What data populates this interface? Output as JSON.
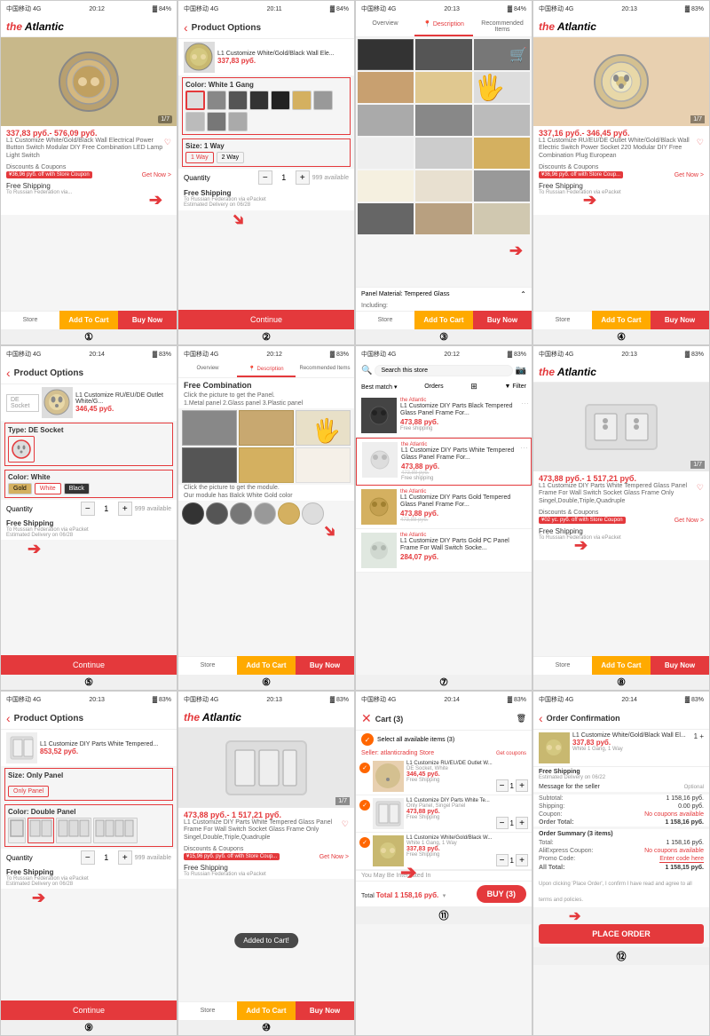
{
  "cells": [
    {
      "id": 1,
      "type": "product_detail",
      "logo": "the Atlantic",
      "status": "中国移动 4G  20:12  84%",
      "product_img": "round_switch_gold",
      "price": "337,83 руб.- 576,09 руб.",
      "desc": "L1 Customize White/Gold/Black Wall Electrical Power Button Switch Modular DIY Free Combination LED Lamp Light Switch",
      "discount_text": "¥36,96 руб. off with Store Coupon",
      "free_shipping": "Free Shipping",
      "ship_sub": "To Russian Federation via...",
      "has_arrow": true,
      "arrow_pos": "left",
      "num": "①"
    },
    {
      "id": 2,
      "type": "product_options",
      "status": "中国移动 4G  20:11  84%",
      "title": "Product Options",
      "product_name": "L1 Customize White/Gold/Black Wall Ele...",
      "price": "337,83 руб.",
      "color_label": "Color: White 1 Gang",
      "size_label": "Size: 1 Way",
      "size_options": [
        "1 Way",
        "2 Way"
      ],
      "qty_label": "Quantity",
      "free_shipping": "Free Shipping",
      "ship_sub": "To Russian Federation via ePacket\nEstimated Delivery on 06/28",
      "has_arrow": true,
      "num": "②"
    },
    {
      "id": 3,
      "type": "product_gallery",
      "status": "中国移动 4G  20:13  84%",
      "tabs": [
        "Overview",
        "Description",
        "Recommended Items"
      ],
      "panel_label": "Panel Material: Tempered Glass",
      "including": "Including:",
      "has_cart_icon": true,
      "has_arrow": true,
      "num": "③"
    },
    {
      "id": 4,
      "type": "product_detail",
      "logo": "the Atlantic",
      "status": "中国移动 4G  20:13  83%",
      "product_img": "round_socket_white",
      "price": "337,16 руб.- 346,45 руб.",
      "desc": "L1 Customize RU/EU/DE Outlet White/Gold/Black Wall Electric Switch Power Socket 220 Modular DIY Free Combination Plug European",
      "discount_text": "¥36,96 руб. off with Store Coup...",
      "free_shipping": "Free Shipping",
      "ship_sub": "To Russian Federation via ePacket",
      "has_arrow": true,
      "num": "④"
    },
    {
      "id": 5,
      "type": "product_options_2",
      "status": "中国移动 4G  20:14  83%",
      "title": "Product Options",
      "product_name": "L1 Customize RU/EU/DE Outlet White/G...",
      "price": "346,45 руб.",
      "type_label": "Type: DE Socket",
      "color_label": "Color: White",
      "colors": [
        "Gold",
        "White",
        "Black"
      ],
      "qty_label": "Quantity",
      "free_shipping": "Free Shipping",
      "ship_sub": "To Russian Federation via ePacket\nEstimated Delivery on 06/28",
      "has_arrow": true,
      "num": "⑤"
    },
    {
      "id": 6,
      "type": "free_combination",
      "status": "中国移动 4G  20:12  83%",
      "tabs": [
        "Overview",
        "Description",
        "Recommended Items"
      ],
      "title": "Free Combination",
      "sub1": "Click the picture to get the Panel.",
      "sub2": "1.Metal panel  2.Glass panel  3.Plastic panel",
      "sub3": "Click the picture to get the module.",
      "sub4": "Our module has Back White Gold color",
      "has_arrow": true,
      "num": "⑥"
    },
    {
      "id": 7,
      "type": "search_results",
      "status": "中国移动 4G  20:12  83%",
      "search_placeholder": "Search this store",
      "sort_label": "Best match",
      "orders_label": "Orders",
      "filter_label": "Filter",
      "items": [
        {
          "brand": "the Atlantic",
          "name": "L1 Customize DIY Parts Black Tempered Glass Panel Frame For...",
          "price": "473,88 руб.",
          "old_price": "",
          "shipping": "Free shipping"
        },
        {
          "brand": "the Atlantic",
          "name": "L1 Customize DIY Parts White Tempered Glass Panel Frame For...",
          "price": "473,88 руб.",
          "old_price": "473,88 руб.",
          "shipping": "Free shipping"
        },
        {
          "brand": "the Atlantic",
          "name": "L1 Customize DIY Parts Gold Tempered Glass Panel Frame For...",
          "price": "473,88 руб.",
          "old_price": "473,88 руб.",
          "shipping": "Free shipping"
        },
        {
          "brand": "the Atlantic",
          "name": "L1 Customize DIY Parts Gold PC Panel Frame For Wall Switch Socke...",
          "price": "284,07 руб.",
          "old_price": "",
          "shipping": ""
        }
      ],
      "has_arrow": true,
      "num": "⑦"
    },
    {
      "id": 8,
      "type": "product_detail_2",
      "logo": "the Atlantic",
      "status": "中国移动 4G  20:13  83%",
      "product_img": "frame_panel_white",
      "price": "473,88 руб.- 1 517,21 руб.",
      "desc": "L1 Customize DIY Parts White Tempered Glass Panel Frame For Wall Switch Socket Glass Frame Only Singel,Double,Triple,Quadruple",
      "discount_text": "¥02 ус. руб. off with Store Coupon",
      "free_shipping": "Free Shipping",
      "ship_sub": "To Russian Federation via ePacket",
      "has_arrow": true,
      "num": "⑧"
    },
    {
      "id": 9,
      "type": "product_options_3",
      "status": "中国移动 4G  20:13  83%",
      "title": "Product Options",
      "product_name": "L1 Customize DIY Parts White Tempered...",
      "price": "853,52 руб.",
      "size_label": "Size: Only Panel",
      "size_options": [
        "Only Panel"
      ],
      "color_label": "Color: Double Panel",
      "qty_label": "Quantity",
      "free_shipping": "Free Shipping",
      "ship_sub": "To Russian Federation via ePacket\nEstimated Delivery on 06/28",
      "has_arrow": true,
      "num": "⑨"
    },
    {
      "id": 10,
      "type": "product_detail_3",
      "logo": "the Atlantic",
      "status": "中国移动 4G  20:13  83%",
      "product_img": "frame_panel_white_2",
      "price": "473,88 руб.- 1 517,21 руб.",
      "desc": "L1 Customize DIY Parts White Tempered Glass Panel Frame For Wall Switch Socket Glass Frame Only Singel,Double,Triple,Quadruple",
      "discount_text": "¥15,96 руб. руб. off with Store Coup...",
      "toast": "Added to Cart!",
      "ship_sub": "To Russian Federation via ePacket",
      "has_arrow": false,
      "num": "⑩"
    },
    {
      "id": 11,
      "type": "cart",
      "status": "中国移动 4G  20:14  83%",
      "title": "Cart (3)",
      "select_all": "Select all available items (3)",
      "seller": "Seller: atlanticrading Store",
      "get_coupons": "Get coupons",
      "items": [
        {
          "name": "L1 Customize RU/EU/DE Outlet W...",
          "price": "346,45 руб.",
          "variant": "DE Socket, White",
          "shipping": "Free Shipping",
          "qty": 1
        },
        {
          "name": "L1 Customize DIY Parts White Te...",
          "price": "473,88 руб.",
          "variant": "Only Panel, Singel Panel",
          "shipping": "Free Shipping",
          "qty": 1
        },
        {
          "name": "L1 Customize White/Gold/Black W...",
          "price": "337,83 руб.",
          "variant": "White 1 Gang, 1 Way",
          "shipping": "Free Shipping",
          "qty": 1
        }
      ],
      "maybe_interested": "You May Be Interested In",
      "total": "Total 1 158,16 руб.",
      "buy_btn": "BUY (3)",
      "has_arrow": true,
      "num": "⑪"
    },
    {
      "id": 12,
      "type": "order_confirmation",
      "status": "中国移动 4G  20:14  83%",
      "title": "Order Confirmation",
      "item_name": "L1 Customize White/Gold/Black Wall El...",
      "item_price": "337,83 руб.",
      "item_variant": "White 1 Gang, 1 Way",
      "shipping_label": "Free Shipping",
      "ship_est": "Estimated Delivery on 06/22",
      "message_label": "Message for the seller",
      "message_opt": "Optional",
      "subtotal_label": "Subtotal:",
      "subtotal_val": "1 158,16 руб.",
      "shipping_val": "0.00 руб.",
      "coupon_label": "Coupon:",
      "coupon_val": "No coupons available",
      "order_total_label": "Order Total:",
      "order_total_val": "1 158,16 руб.",
      "summary_title": "Order Summary (3 items)",
      "total_label": "Total:",
      "total_val": "1 158,16 руб.",
      "ali_coupon": "AliExpress Coupon:",
      "ali_val": "No coupons available",
      "promo_label": "Promo Code:",
      "promo_val": "Enter code here",
      "all_total_label": "All Total:",
      "all_total_val": "1 158,15 руб.",
      "agree_text": "Upon clicking 'Place Order', I confirm I have read and agree to all terms and policies.",
      "place_order": "PLACE ORDER",
      "all_total_bottom": "1 158,15 руб.",
      "has_arrow": true,
      "num": "⑫"
    }
  ],
  "colors": {
    "red": "#e4393c",
    "orange": "#ff6600",
    "yellow": "#ffaa00",
    "bg": "#f5f5f5",
    "text": "#333333",
    "subtext": "#999999",
    "white": "#ffffff"
  }
}
